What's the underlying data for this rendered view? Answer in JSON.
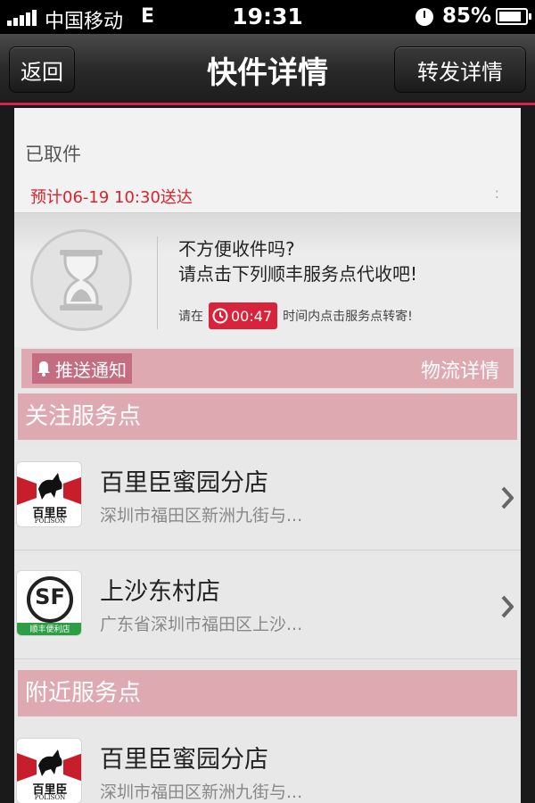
{
  "status_bar": {
    "carrier": "中国移动",
    "network": "E",
    "time": "19:31",
    "battery": "85%",
    "battery_level": 0.85
  },
  "nav": {
    "back_label": "返回",
    "title": "快件详情",
    "forward_label": "转发详情",
    "accent_color": "#d9234a"
  },
  "shipment": {
    "status": "已取件",
    "eta": "预计06-19 10:30送达",
    "more": ":"
  },
  "collect": {
    "question": "不方便收件吗?",
    "tip": "请点击下列顺丰服务点代收吧!",
    "time_prefix": "请在",
    "countdown": "00:47",
    "time_suffix": "时间内点击服务点转寄!"
  },
  "actions": {
    "push_label": "推送通知",
    "logistics_label": "物流详情"
  },
  "sections": {
    "followed": "关注服务点",
    "nearby": "附近服务点"
  },
  "followed_stores": [
    {
      "name": "百里臣蜜园分店",
      "address": "深圳市福田区新洲九街与...",
      "logo": "polison",
      "logo_text": "百里臣",
      "logo_sub": "POLISON"
    },
    {
      "name": "上沙东村店",
      "address": "广东省深圳市福田区上沙...",
      "logo": "sf",
      "logo_text": "SF",
      "logo_sub": "顺丰便利店"
    }
  ],
  "nearby_stores": [
    {
      "name": "百里臣蜜园分店",
      "address": "深圳市福田区新洲九街与...",
      "logo": "polison",
      "logo_text": "百里臣",
      "logo_sub": "POLISON"
    }
  ]
}
